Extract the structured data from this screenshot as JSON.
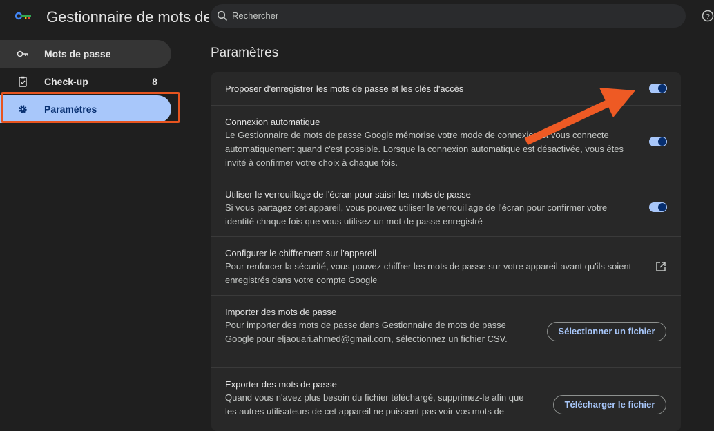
{
  "header": {
    "app_title": "Gestionnaire de mots de passe",
    "search_placeholder": "Rechercher"
  },
  "sidebar": {
    "items": [
      {
        "label": "Mots de passe",
        "icon": "key-icon"
      },
      {
        "label": "Check-up",
        "icon": "clipboard-check-icon",
        "count": "8"
      },
      {
        "label": "Paramètres",
        "icon": "gear-icon"
      }
    ]
  },
  "main": {
    "title": "Paramètres",
    "settings": [
      {
        "title": "Proposer d'enregistrer les mots de passe et les clés d'accès",
        "toggle_on": true
      },
      {
        "title": "Connexion automatique",
        "desc": "Le Gestionnaire de mots de passe Google mémorise votre mode de connexion et vous connecte automatiquement quand c'est possible. Lorsque la connexion automatique est désactivée, vous êtes invité à confirmer votre choix à chaque fois.",
        "toggle_on": true
      },
      {
        "title": "Utiliser le verrouillage de l'écran pour saisir les mots de passe",
        "desc": "Si vous partagez cet appareil, vous pouvez utiliser le verrouillage de l'écran pour confirmer votre identité chaque fois que vous utilisez un mot de passe enregistré",
        "toggle_on": true
      },
      {
        "title": "Configurer le chiffrement sur l'appareil",
        "desc": "Pour renforcer la sécurité, vous pouvez chiffrer les mots de passe sur votre appareil avant qu'ils soient enregistrés dans votre compte Google",
        "icon": "open-in-new-icon"
      },
      {
        "title": "Importer des mots de passe",
        "desc": "Pour importer des mots de passe dans Gestionnaire de mots de passe Google pour eljaouari.ahmed@gmail.com, sélectionnez un fichier CSV.",
        "button": "Sélectionner un fichier"
      },
      {
        "title": "Exporter des mots de passe",
        "desc": "Quand vous n'avez plus besoin du fichier téléchargé, supprimez-le afin que les autres utilisateurs de cet appareil ne puissent pas voir vos mots de",
        "button": "Télécharger le fichier"
      }
    ]
  },
  "colors": {
    "accent": "#a8c7fa",
    "highlight": "#e7541f",
    "arrow": "#ee5a24"
  }
}
